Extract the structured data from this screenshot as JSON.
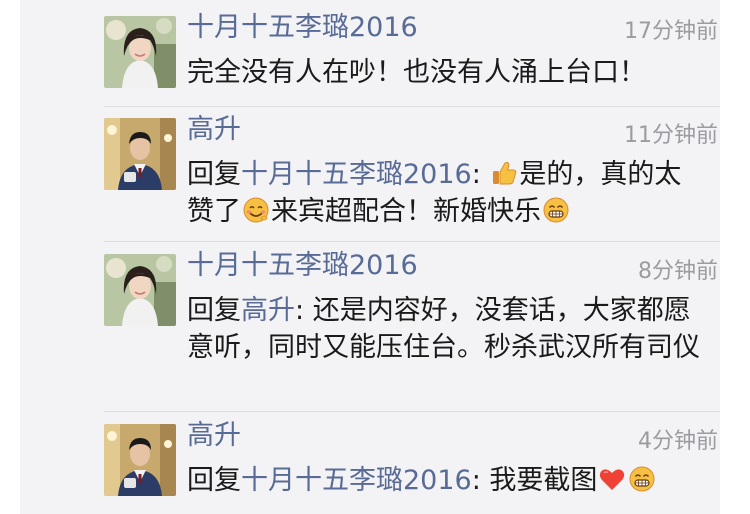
{
  "comments": [
    {
      "author": "十月十五李璐2016",
      "time": "17分钟前",
      "text": "完全没有人在吵！也没有人涌上台口！",
      "avatar_icon": "woman-portrait-avatar"
    },
    {
      "author": "高升",
      "time": "11分钟前",
      "reply_prefix": "回复",
      "reply_to": "十月十五李璐2016",
      "colon": ":",
      "text_a": "是的，真的太赞了",
      "text_b": "来宾超配合！新婚快乐",
      "emoji_a": "thumbs-up-icon",
      "emoji_b": "smiling-face-icon",
      "emoji_c": "grinning-face-icon",
      "avatar_icon": "man-portrait-avatar"
    },
    {
      "author": "十月十五李璐2016",
      "time": "8分钟前",
      "reply_prefix": "回复",
      "reply_to": "高升",
      "colon": ":",
      "text": "还是内容好，没套话，大家都愿意听，同时又能压住台。秒杀武汉所有司仪",
      "avatar_icon": "woman-portrait-avatar"
    },
    {
      "author": "高升",
      "time": "4分钟前",
      "reply_prefix": "回复",
      "reply_to": "十月十五李璐2016",
      "colon": ":",
      "text": "我要截图",
      "emoji_a": "heart-icon",
      "emoji_b": "grinning-face-icon",
      "avatar_icon": "man-portrait-avatar"
    }
  ],
  "colors": {
    "panel_background": "#f3f3f5",
    "name_link": "#586b96",
    "time_text": "#9b9ba0",
    "body_text": "#1a1a1a",
    "divider": "#dedee2"
  }
}
